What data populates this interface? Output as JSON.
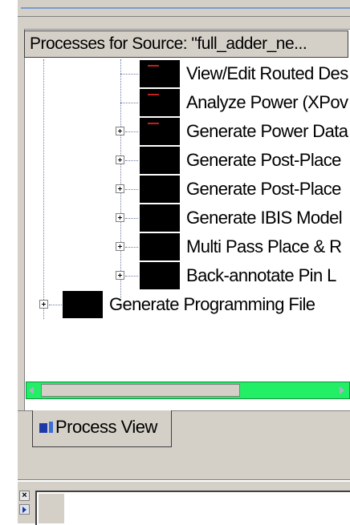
{
  "panel": {
    "header": "Processes for Source: \"full_adder_ne..."
  },
  "tree": {
    "items": [
      {
        "label": "View/Edit Routed Des",
        "icon": "process-icon-red",
        "expandable": false
      },
      {
        "label": "Analyze Power (XPov",
        "icon": "process-icon-red",
        "expandable": false
      },
      {
        "label": "Generate Power Data",
        "icon": "process-icon-red",
        "expandable": true
      },
      {
        "label": "Generate Post-Place",
        "icon": "process-icon",
        "expandable": true
      },
      {
        "label": "Generate Post-Place",
        "icon": "process-icon",
        "expandable": true
      },
      {
        "label": "Generate IBIS Model",
        "icon": "process-icon",
        "expandable": true
      },
      {
        "label": "Multi Pass Place & R",
        "icon": "process-icon",
        "expandable": true
      },
      {
        "label": "Back-annotate Pin L",
        "icon": "process-icon",
        "expandable": true
      },
      {
        "label": "Generate Programming File",
        "icon": "process-icon",
        "expandable": true
      }
    ]
  },
  "tabs": {
    "process_view": "Process View"
  },
  "bottom": {
    "close_glyph": "×"
  }
}
